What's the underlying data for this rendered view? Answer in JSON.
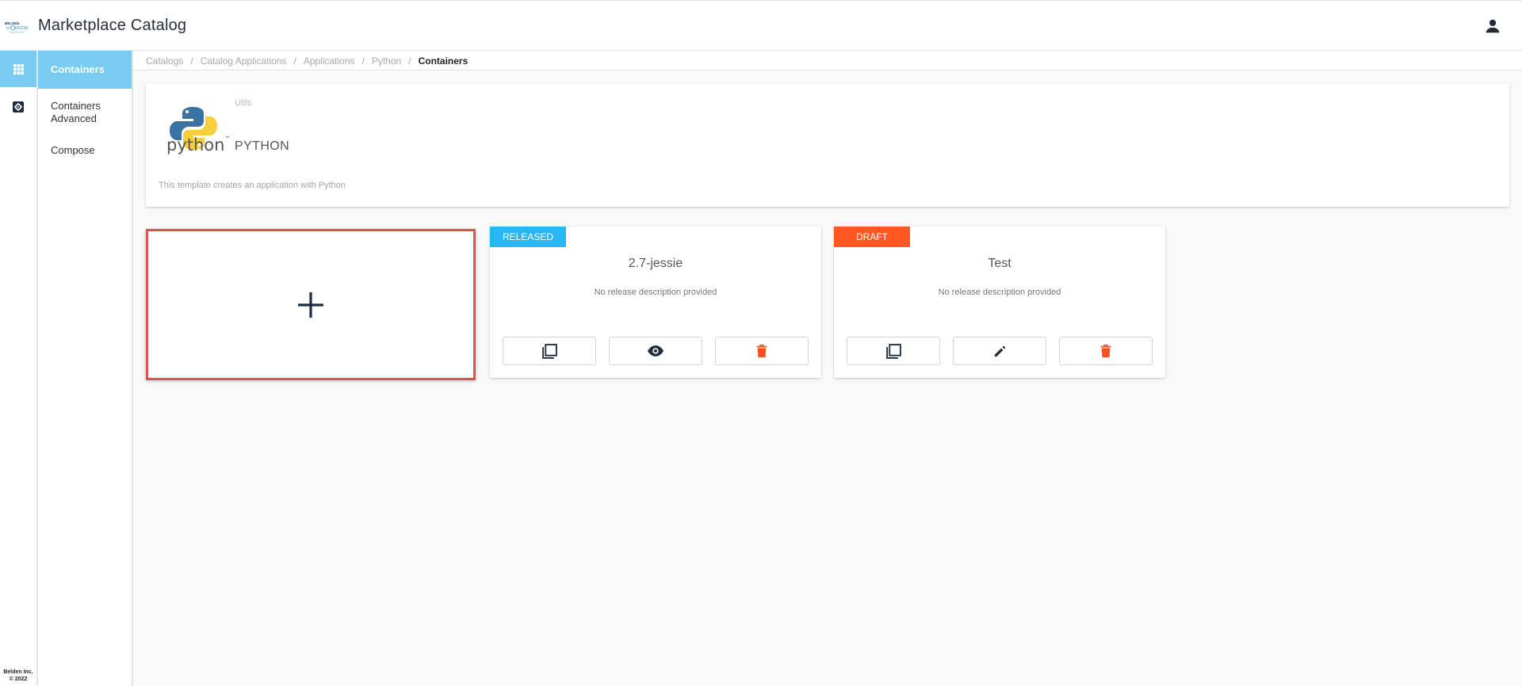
{
  "header": {
    "title": "Marketplace Catalog",
    "logo_text": "BELDEN HORIZON",
    "user_icon": "user-icon"
  },
  "rail": {
    "items": [
      {
        "icon": "apps-grid-icon",
        "active": true
      },
      {
        "icon": "settings-box-icon",
        "active": false
      }
    ],
    "footer_line1": "Belden Inc.",
    "footer_line2": "© 2022"
  },
  "subnav": {
    "items": [
      {
        "label": "Containers",
        "active": true
      },
      {
        "label": "Containers Advanced",
        "active": false
      },
      {
        "label": "Compose",
        "active": false
      }
    ]
  },
  "breadcrumb": {
    "items": [
      "Catalogs",
      "Catalog Applications",
      "Applications",
      "Python",
      "Containers"
    ],
    "separator": "/"
  },
  "app": {
    "category": "Utils",
    "name": "PYTHON",
    "logo_word": "python",
    "logo_tm": "™",
    "description": "This template creates an application with Python"
  },
  "add_card": {
    "icon": "plus-icon"
  },
  "versions": [
    {
      "status": "RELEASED",
      "status_color": "#29b6f6",
      "title": "2.7-jessie",
      "description": "No release description provided",
      "actions": [
        "copy-icon",
        "view-icon",
        "delete-icon"
      ]
    },
    {
      "status": "DRAFT",
      "status_color": "#ff5722",
      "title": "Test",
      "description": "No release description provided",
      "actions": [
        "copy-icon",
        "edit-icon",
        "delete-icon"
      ]
    }
  ],
  "colors": {
    "accent": "#79cbf2",
    "danger": "#f4511e",
    "icon_dark": "#1f2d3d",
    "selection_border": "#d9534f"
  }
}
